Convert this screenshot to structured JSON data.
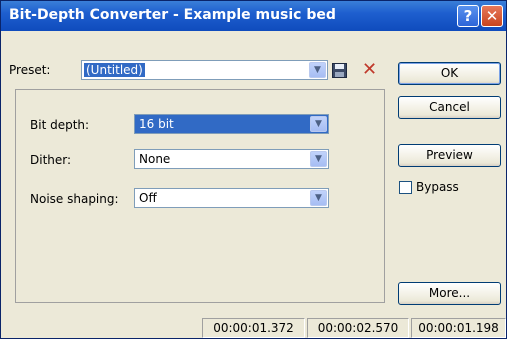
{
  "window": {
    "title": "Bit-Depth Converter - Example music bed",
    "help_glyph": "?",
    "close_glyph": "✕"
  },
  "preset": {
    "label": "Preset:",
    "value": "(Untitled)"
  },
  "fields": {
    "bit_depth": {
      "label": "Bit depth:",
      "value": "16 bit"
    },
    "dither": {
      "label": "Dither:",
      "value": "None"
    },
    "noise_shaping": {
      "label": "Noise shaping:",
      "value": "Off"
    }
  },
  "buttons": {
    "ok": "OK",
    "cancel": "Cancel",
    "preview": "Preview",
    "more": "More..."
  },
  "bypass": {
    "label": "Bypass",
    "checked": false
  },
  "status": [
    "00:00:01.372",
    "00:00:02.570",
    "00:00:01.198"
  ],
  "icons": {
    "save": "floppy-disk-icon",
    "delete": "delete-x-icon",
    "dropdown": "chevron-down-icon"
  }
}
